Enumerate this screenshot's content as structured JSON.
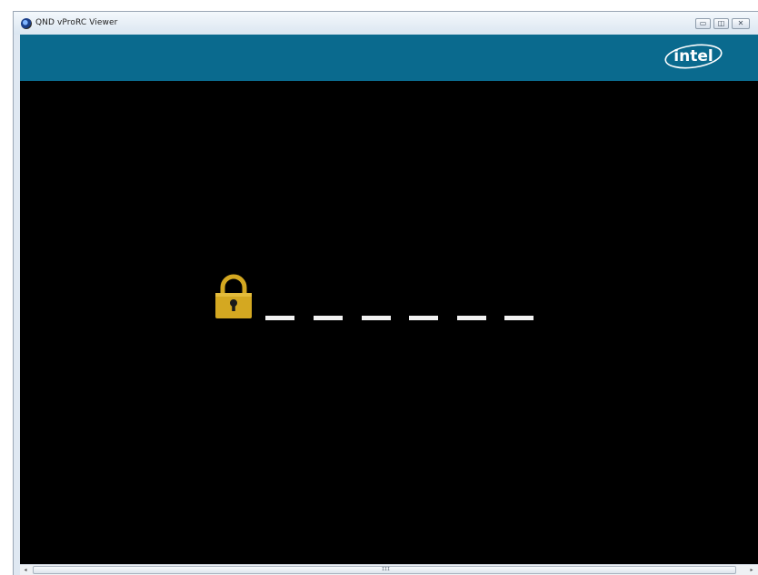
{
  "window": {
    "title": "QND vProRC Viewer",
    "controls": {
      "minimize_glyph": "▭",
      "maximize_glyph": "◫",
      "close_glyph": "✕"
    }
  },
  "header": {
    "logo_text": "intel",
    "logo_icon": "intel-logo",
    "background_color": "#0a6a8e"
  },
  "lock_screen": {
    "icon": "padlock-icon",
    "icon_color": "#d4a821",
    "pin_slots": 6
  },
  "scrollbar": {
    "left_arrow": "◂",
    "right_arrow": "▸",
    "grip": "III"
  }
}
